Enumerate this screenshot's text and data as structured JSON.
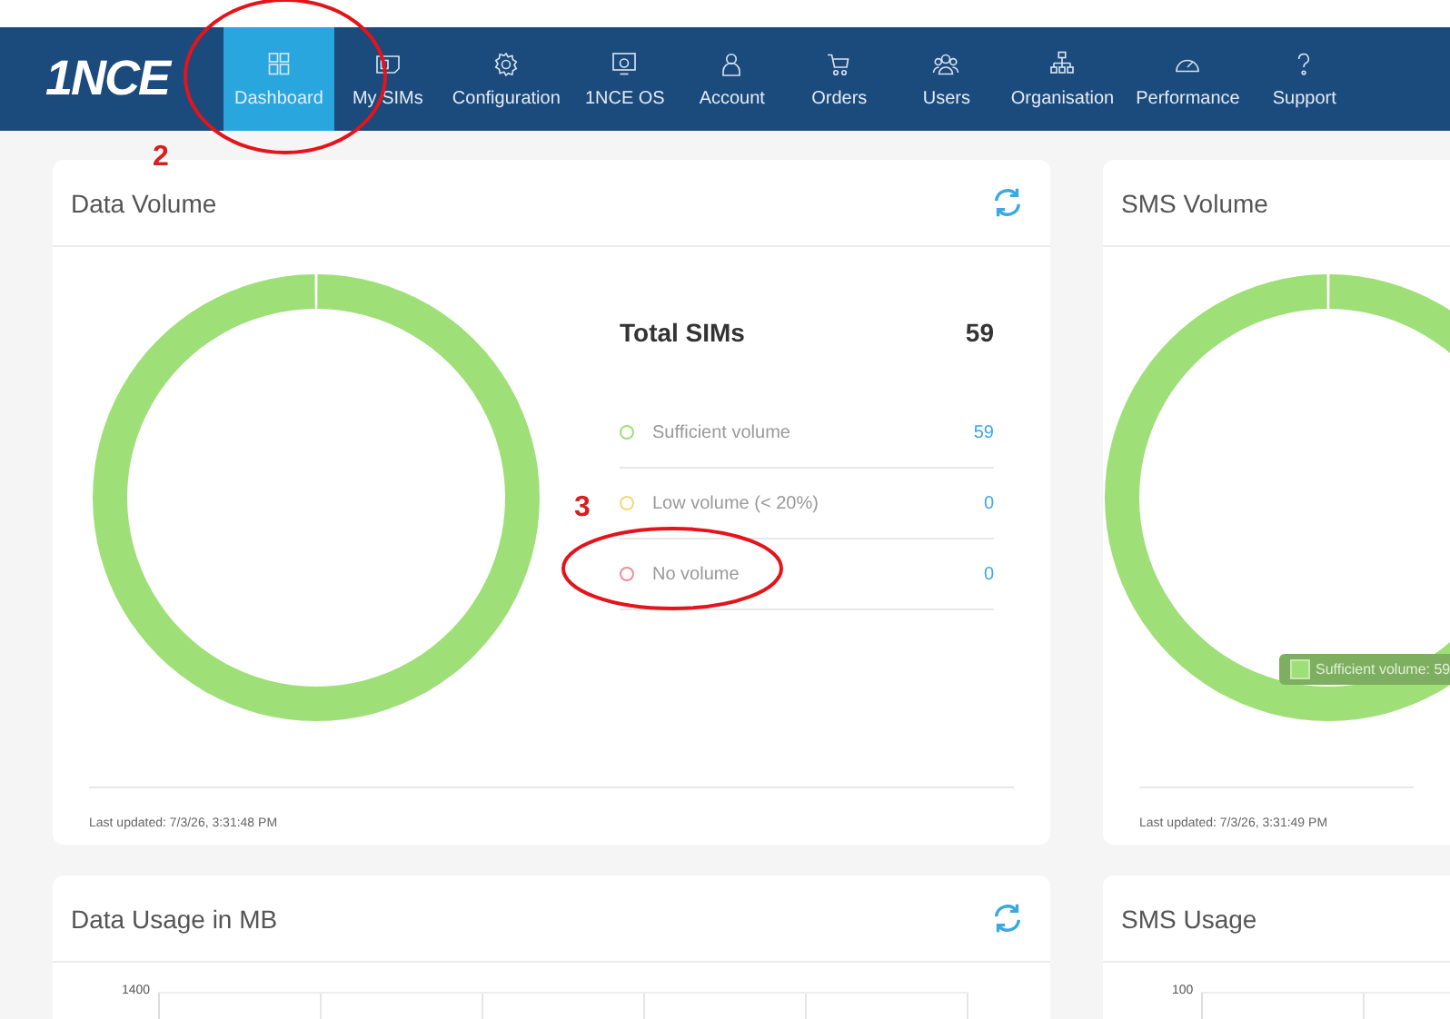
{
  "nav": {
    "logo": "1NCE",
    "items": [
      {
        "label": "Dashboard",
        "selected": true
      },
      {
        "label": "My SIMs",
        "selected": false
      },
      {
        "label": "Configuration",
        "selected": false
      },
      {
        "label": "1NCE OS",
        "selected": false
      },
      {
        "label": "Account",
        "selected": false
      },
      {
        "label": "Orders",
        "selected": false
      },
      {
        "label": "Users",
        "selected": false
      },
      {
        "label": "Organisation",
        "selected": false
      },
      {
        "label": "Performance",
        "selected": false
      },
      {
        "label": "Support",
        "selected": false
      }
    ]
  },
  "cards": [
    {
      "kind": "volume",
      "title": "Data Volume",
      "refresh": true,
      "total": {
        "label": "Total SIMs",
        "value": "59"
      },
      "legend": [
        {
          "label": "Sufficient volume",
          "value": "59",
          "color": "#9fdf78"
        },
        {
          "label": "Low volume (< 20%)",
          "value": "0",
          "color": "#f3d87a"
        },
        {
          "label": "No volume",
          "value": "0",
          "color": "#ee8e96"
        }
      ],
      "last_updated": "Last updated: 7/3/26, 3:31:48 PM"
    },
    {
      "kind": "volume",
      "title": "SMS Volume",
      "refresh": false,
      "tooltip": "Sufficient volume: 59",
      "last_updated": "Last updated: 7/3/26, 3:31:49 PM"
    },
    {
      "kind": "usage",
      "title": "Data Usage in MB",
      "refresh": true,
      "top_tick": "1400"
    },
    {
      "kind": "usage",
      "title": "SMS Usage",
      "refresh": false,
      "top_tick": "100"
    }
  ],
  "annotations": [
    {
      "number": "2"
    },
    {
      "number": "3"
    }
  ]
}
